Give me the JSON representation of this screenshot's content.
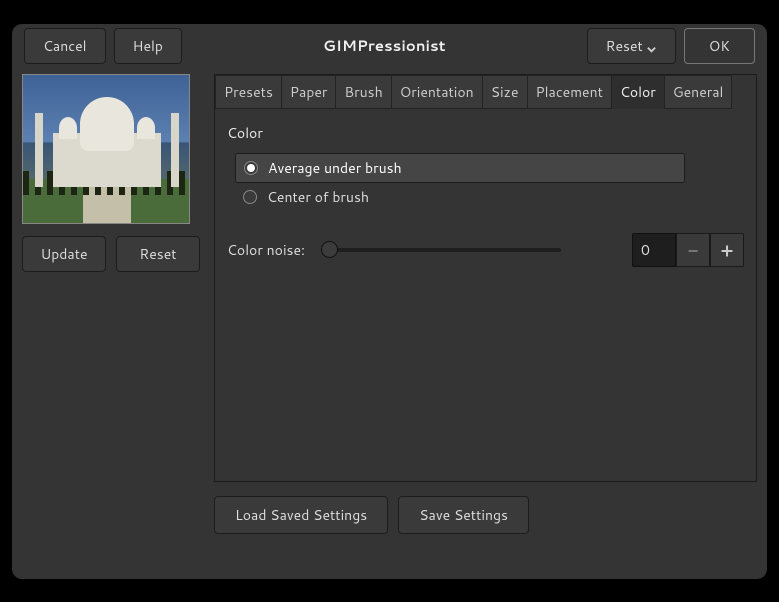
{
  "title": "GIMPressionist",
  "titlebar": {
    "cancel": "Cancel",
    "help": "Help",
    "reset": "Reset",
    "ok": "OK"
  },
  "preview": {
    "update": "Update",
    "reset": "Reset"
  },
  "tabs": [
    {
      "id": "presets",
      "label": "Presets"
    },
    {
      "id": "paper",
      "label": "Paper"
    },
    {
      "id": "brush",
      "label": "Brush"
    },
    {
      "id": "orientation",
      "label": "Orientation"
    },
    {
      "id": "size",
      "label": "Size"
    },
    {
      "id": "placement",
      "label": "Placement"
    },
    {
      "id": "color",
      "label": "Color"
    },
    {
      "id": "general",
      "label": "General"
    }
  ],
  "activeTab": "color",
  "colorTab": {
    "sectionTitle": "Color",
    "options": {
      "average": "Average under brush",
      "center": "Center of brush"
    },
    "selected": "average",
    "noiseLabel": "Color noise:",
    "noiseValue": "0"
  },
  "footer": {
    "load": "Load Saved Settings",
    "save": "Save Settings"
  }
}
